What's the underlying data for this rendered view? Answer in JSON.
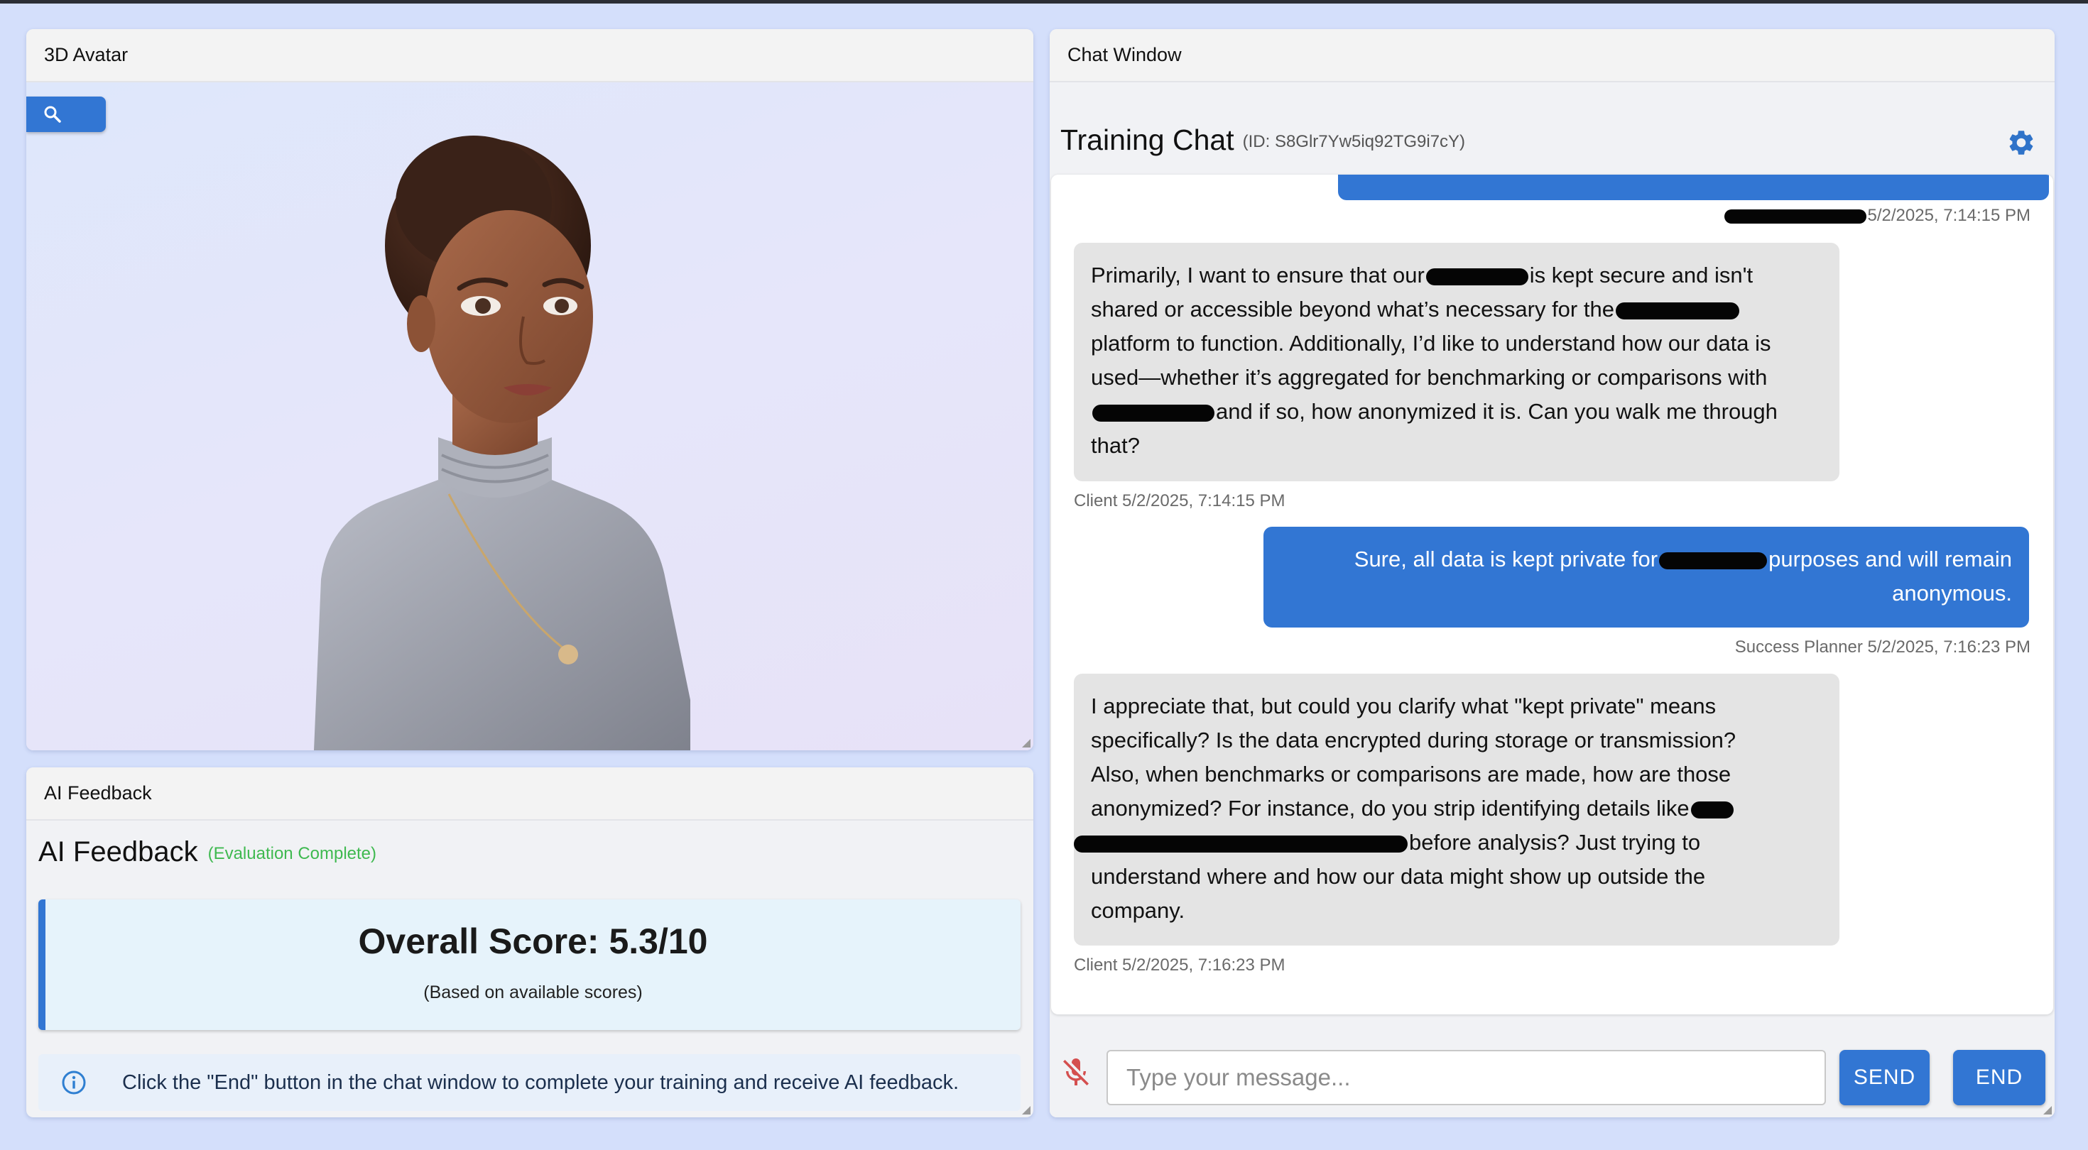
{
  "avatar_panel": {
    "header": "3D Avatar",
    "zoom_icon": "search-icon"
  },
  "feedback_panel": {
    "header": "AI Feedback",
    "title": "AI Feedback",
    "status": "(Evaluation Complete)",
    "score_title": "Overall Score: 5.3/10",
    "score_subtitle": "(Based on available scores)",
    "info_icon": "info-icon",
    "info_text": "Click the \"End\" button in the chat window to complete your training and receive AI feedback."
  },
  "chat_panel": {
    "header": "Chat Window",
    "title": "Training Chat",
    "chat_id": "(ID: S8Glr7Yw5iq92TG9i7cY)",
    "settings_icon": "gear-icon",
    "messages": [
      {
        "sender": "Client",
        "timestamp": "5/2/2025, 7:14:15 PM",
        "meta": "Client 5/2/2025, 7:14:15 PM",
        "lines": [
          [
            "Primarily, I want to ensure that our",
            "is kept secure and isn't"
          ],
          [
            "shared or accessible beyond what’s necessary for the"
          ],
          [
            "platform to function. Additionally, I’d like to understand how our data is"
          ],
          [
            "used—whether it’s aggregated for benchmarking or comparisons with"
          ],
          [
            "",
            "and if so, how anonymized it is. Can you walk me through"
          ],
          [
            "that?"
          ]
        ]
      },
      {
        "sender": "Success Planner",
        "timestamp": "5/2/2025, 7:16:23 PM",
        "meta": "Success Planner 5/2/2025, 7:16:23 PM",
        "lines": [
          [
            "Sure, all data is kept private for",
            "purposes and will remain"
          ],
          [
            "anonymous."
          ]
        ]
      },
      {
        "sender": "Client",
        "timestamp": "5/2/2025, 7:16:23 PM",
        "meta": "Client 5/2/2025, 7:16:23 PM",
        "lines": [
          [
            "I appreciate that, but could you clarify what \"kept private\" means"
          ],
          [
            "specifically? Is the data encrypted during storage or transmission?"
          ],
          [
            "Also, when benchmarks or comparisons are made, how are those"
          ],
          [
            "anonymized? For instance, do you strip identifying details like"
          ],
          [
            "",
            "before analysis? Just trying to"
          ],
          [
            "understand where and how our data might show up outside the"
          ],
          [
            "company."
          ]
        ]
      }
    ],
    "prev_meta_partial": "5/2/2025, 7:14:15 PM",
    "input_placeholder": "Type your message...",
    "mic_icon": "mic-off-icon",
    "send_label": "SEND",
    "end_label": "END"
  }
}
